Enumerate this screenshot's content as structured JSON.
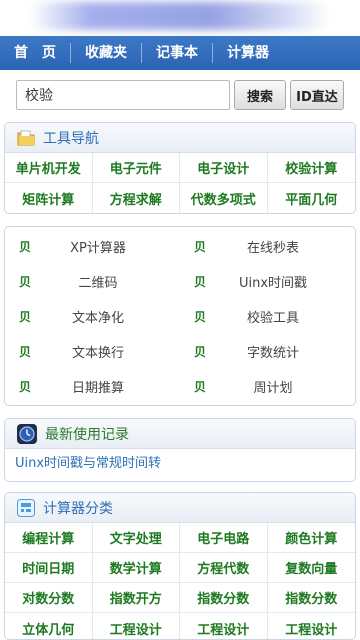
{
  "nav": [
    "首　页",
    "收藏夹",
    "记事本",
    "计算器"
  ],
  "search": {
    "value": "校验",
    "search_btn": "搜索",
    "id_btn": "ID直达"
  },
  "tools": {
    "title": "工具导航",
    "items": [
      "单片机开发",
      "电子元件",
      "电子设计",
      "校验计算",
      "矩阵计算",
      "方程求解",
      "代数多项式",
      "平面几何"
    ]
  },
  "apps": {
    "icon_glyph": "贝",
    "items": [
      "XP计算器",
      "在线秒表",
      "二维码",
      "Uinx时间戳",
      "文本净化",
      "校验工具",
      "文本换行",
      "字数统计",
      "日期推算",
      "周计划"
    ]
  },
  "recent": {
    "title": "最新使用记录",
    "link": "Uinx时间戳与常规时间转"
  },
  "categories": {
    "title": "计算器分类",
    "items": [
      "编程计算",
      "文字处理",
      "电子电路",
      "颜色计算",
      "时间日期",
      "数学计算",
      "方程代数",
      "复数向量",
      "对数分数",
      "指数开方",
      "指数分数",
      "指数分数",
      "立体几何",
      "工程设计",
      "工程设计",
      "工程设计"
    ]
  }
}
